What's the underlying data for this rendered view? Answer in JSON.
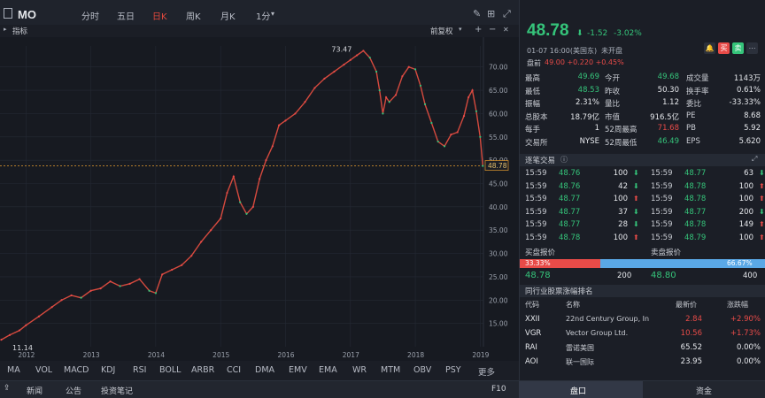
{
  "toolbar": {
    "ticker": "MO",
    "timeframes": [
      "分时",
      "五日",
      "日K",
      "周K",
      "月K",
      "1分"
    ],
    "active_timeframe": "日K"
  },
  "subbar": {
    "indicator_label": "指标",
    "adjust_label": "前复权"
  },
  "chart_data": {
    "type": "line",
    "x_ticks": [
      "2012",
      "2013",
      "2014",
      "2015",
      "2016",
      "2017",
      "2018",
      "2019"
    ],
    "y_ticks": [
      "70.00",
      "65.00",
      "60.00",
      "55.00",
      "50.00",
      "45.00",
      "40.00",
      "35.00",
      "30.00",
      "25.00",
      "20.00",
      "15.00"
    ],
    "ylim": [
      10,
      74.5
    ],
    "xlim": [
      2011.6,
      2019.05
    ],
    "annotations": {
      "high": "73.47",
      "low": "11.14",
      "current": "48.78"
    },
    "series": [
      {
        "x": [
          2011.62,
          2011.75,
          2011.9,
          2012.0,
          2012.2,
          2012.4,
          2012.55,
          2012.7,
          2012.85,
          2013.0,
          2013.15,
          2013.3,
          2013.45,
          2013.6,
          2013.75,
          2013.9,
          2014.0,
          2014.1,
          2014.25,
          2014.4,
          2014.55,
          2014.7,
          2014.85,
          2015.0,
          2015.1,
          2015.2,
          2015.3,
          2015.4,
          2015.5,
          2015.6,
          2015.7,
          2015.8,
          2015.9,
          2016.0,
          2016.15,
          2016.3,
          2016.45,
          2016.6,
          2016.75,
          2016.9,
          2017.0,
          2017.1,
          2017.2,
          2017.3,
          2017.4,
          2017.45,
          2017.5,
          2017.55,
          2017.6,
          2017.7,
          2017.8,
          2017.9,
          2018.0,
          2018.08,
          2018.15,
          2018.25,
          2018.35,
          2018.45,
          2018.55,
          2018.65,
          2018.75,
          2018.82,
          2018.88,
          2018.94,
          2019.0,
          2019.04
        ],
        "y": [
          11.5,
          12.5,
          13.5,
          14.6,
          16.5,
          18.5,
          20.0,
          21.0,
          20.5,
          22.0,
          22.5,
          24.0,
          23.0,
          23.5,
          24.5,
          22.0,
          21.5,
          25.5,
          26.5,
          27.5,
          29.5,
          32.5,
          35.0,
          37.5,
          43.0,
          46.5,
          41.0,
          38.5,
          40.0,
          46.0,
          50.0,
          53.0,
          57.5,
          58.5,
          60.0,
          62.5,
          65.5,
          67.5,
          69.0,
          70.5,
          71.5,
          72.5,
          73.47,
          72.0,
          69.0,
          65.0,
          60.0,
          63.5,
          62.5,
          64.0,
          68.0,
          70.0,
          69.5,
          66.0,
          62.0,
          58.0,
          54.0,
          53.0,
          55.5,
          56.0,
          59.5,
          63.5,
          65.0,
          60.5,
          55.0,
          48.78
        ]
      }
    ]
  },
  "chart_aux": {
    "axis_tag": "48.78"
  },
  "indicators": [
    "MA",
    "VOL",
    "MACD",
    "KDJ",
    "RSI",
    "BOLL",
    "ARBR",
    "CCI",
    "DMA",
    "EMV",
    "EMA",
    "WR",
    "MTM",
    "OBV",
    "PSY",
    "更多"
  ],
  "bottom": {
    "news": "新闻",
    "notice": "公告",
    "notes": "投资笔记",
    "f10": "F10",
    "tab_quote": "盘口",
    "tab_funds": "资金"
  },
  "quote": {
    "price": "48.78",
    "change": "-1.52",
    "change_pct": "-3.02%",
    "status_time": "01-07 16:00(美国东)",
    "status": "未开盘",
    "premarket_label": "盘前",
    "premarket_value": "49.00 +0.220 +0.45%",
    "buy_btn": "买",
    "sell_btn": "卖",
    "stats": [
      {
        "l": "最高",
        "v": "49.69",
        "c": "green",
        "l2": "今开",
        "v2": "49.68",
        "c2": "green",
        "l3": "成交量",
        "v3": "1143万",
        "c3": "white"
      },
      {
        "l": "最低",
        "v": "48.53",
        "c": "green",
        "l2": "昨收",
        "v2": "50.30",
        "c2": "white",
        "l3": "换手率",
        "v3": "0.61%",
        "c3": "white"
      },
      {
        "l": "振幅",
        "v": "2.31%",
        "c": "white",
        "l2": "量比",
        "v2": "1.12",
        "c2": "white",
        "l3": "委比",
        "v3": "-33.33%",
        "c3": "white"
      },
      {
        "l": "总股本",
        "v": "18.79亿",
        "c": "white",
        "l2": "市值",
        "v2": "916.5亿",
        "c2": "white",
        "l3": "PE",
        "v3": "8.68",
        "c3": "white"
      },
      {
        "l": "每手",
        "v": "1",
        "c": "white",
        "l2": "52周最高",
        "v2": "71.68",
        "c2": "red",
        "l3": "PB",
        "v3": "5.92",
        "c3": "white"
      },
      {
        "l": "交易所",
        "v": "NYSE",
        "c": "white",
        "l2": "52周最低",
        "v2": "46.49",
        "c2": "green",
        "l3": "EPS",
        "v3": "5.620",
        "c3": "white"
      }
    ]
  },
  "trades": {
    "title": "逐笔交易",
    "left": [
      {
        "t": "15:59",
        "p": "48.76",
        "v": "100",
        "d": "down"
      },
      {
        "t": "15:59",
        "p": "48.76",
        "v": "42",
        "d": "down"
      },
      {
        "t": "15:59",
        "p": "48.77",
        "v": "100",
        "d": "up"
      },
      {
        "t": "15:59",
        "p": "48.77",
        "v": "37",
        "d": "down"
      },
      {
        "t": "15:59",
        "p": "48.77",
        "v": "28",
        "d": "down"
      },
      {
        "t": "15:59",
        "p": "48.78",
        "v": "100",
        "d": "up"
      }
    ],
    "right": [
      {
        "t": "15:59",
        "p": "48.77",
        "v": "63",
        "d": "down"
      },
      {
        "t": "15:59",
        "p": "48.78",
        "v": "100",
        "d": "up"
      },
      {
        "t": "15:59",
        "p": "48.78",
        "v": "100",
        "d": "up"
      },
      {
        "t": "15:59",
        "p": "48.77",
        "v": "200",
        "d": "down"
      },
      {
        "t": "15:59",
        "p": "48.78",
        "v": "149",
        "d": "up"
      },
      {
        "t": "15:59",
        "p": "48.79",
        "v": "100",
        "d": "up"
      }
    ]
  },
  "orderbook": {
    "bid_label": "买盘报价",
    "ask_label": "卖盘报价",
    "bid_pct": "33.33%",
    "ask_pct": "66.67%",
    "bid_ratio": 0.3333,
    "bid_price": "48.78",
    "bid_vol": "200",
    "ask_price": "48.80",
    "ask_vol": "400"
  },
  "peers": {
    "title": "同行业股票涨幅排名",
    "headers": [
      "代码",
      "名称",
      "最新价",
      "涨跌幅"
    ],
    "rows": [
      {
        "code": "XXII",
        "name": "22nd Century Group, In",
        "price": "2.84",
        "pct": "+2.90%",
        "c": "red"
      },
      {
        "code": "VGR",
        "name": "Vector Group Ltd.",
        "price": "10.56",
        "pct": "+1.73%",
        "c": "red"
      },
      {
        "code": "RAI",
        "name": "雷诺美国",
        "price": "65.52",
        "pct": "0.00%",
        "c": "white"
      },
      {
        "code": "AOI",
        "name": "联一国际",
        "price": "23.95",
        "pct": "0.00%",
        "c": "white"
      }
    ]
  },
  "colors": {
    "up": "#e84b48",
    "down": "#35c47a",
    "accent": "#e0483d",
    "ask_bar": "#5aa8e6"
  }
}
